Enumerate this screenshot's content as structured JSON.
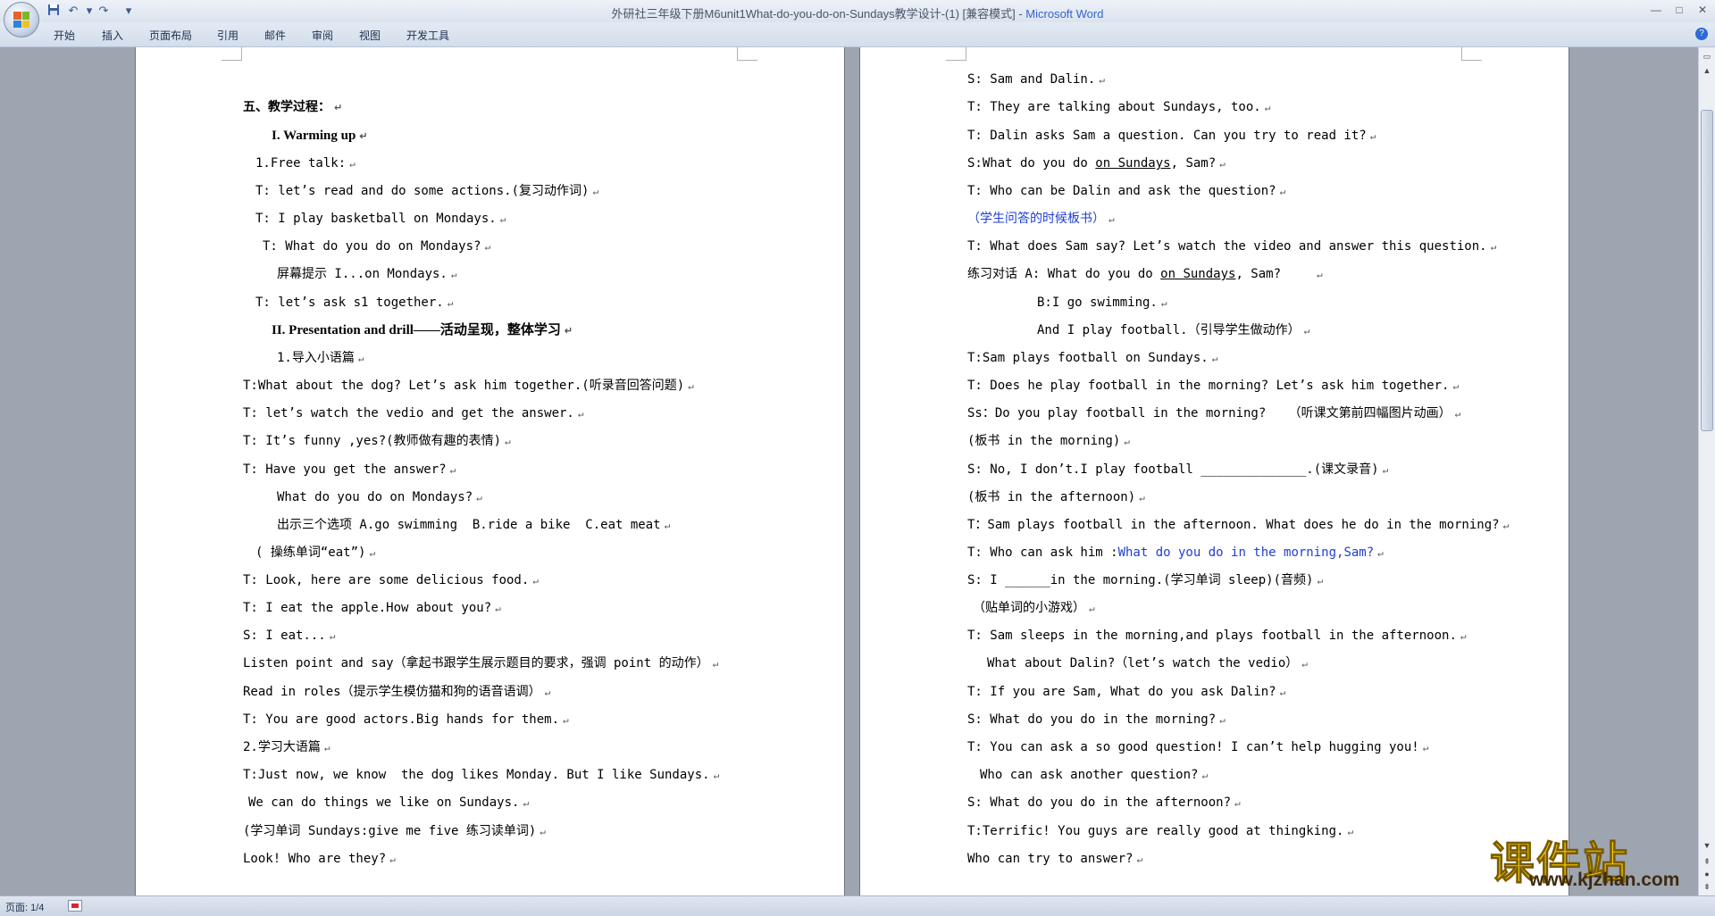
{
  "window": {
    "title": "外研社三年级下册M6unit1What-do-you-do-on-Sundays教学设计-(1) [兼容模式] - ",
    "app_name": "Microsoft Word"
  },
  "qat": {
    "save_icon": "save-icon",
    "undo": "↶",
    "redo": "↷",
    "customize": "▾"
  },
  "window_controls": {
    "minimize": "—",
    "maximize": "□",
    "close": "✕"
  },
  "ribbon": {
    "tabs": [
      "开始",
      "插入",
      "页面布局",
      "引用",
      "邮件",
      "审阅",
      "视图",
      "开发工具"
    ],
    "help": "?"
  },
  "page_left": {
    "lines": [
      {
        "text": "五、教学过程：",
        "style": "heading"
      },
      {
        "text": "I. Warming up",
        "style": "bold"
      },
      {
        "text": "1.Free talk:"
      },
      {
        "text": "T: let’s read and do some actions.(复习动作词)"
      },
      {
        "text": "T: I play basketball on Mondays."
      },
      {
        "text": "T: What do you do on Mondays?"
      },
      {
        "text": "屏幕提示 I...on Mondays."
      },
      {
        "text": "T: let’s ask s1 together."
      },
      {
        "text": "II. Presentation and drill——活动呈现，整体学习",
        "style": "bold"
      },
      {
        "text": "1.导入小语篇"
      },
      {
        "text": "T:What about the dog? Let’s ask him together.(听录音回答问题)"
      },
      {
        "text": "T: let’s watch the vedio and get the answer."
      },
      {
        "text": "T: It’s funny ,yes?(教师做有趣的表情)"
      },
      {
        "text": "T: Have you get the answer?"
      },
      {
        "text": "What do you do on Mondays?"
      },
      {
        "text": "出示三个选项 A.go swimming  B.ride a bike  C.eat meat"
      },
      {
        "text": "( 操练单词“eat”)"
      },
      {
        "text": "T: Look, here are some delicious food."
      },
      {
        "text": "T: I eat the apple.How about you?"
      },
      {
        "text": "S: I eat..."
      },
      {
        "text": "Listen point and say（拿起书跟学生展示题目的要求，强调 point 的动作）"
      },
      {
        "text": "Read in roles（提示学生模仿猫和狗的语音语调）"
      },
      {
        "text": "T: You are good actors.Big hands for them."
      },
      {
        "text": "2.学习大语篇"
      },
      {
        "text": "T:Just now, we know  the dog likes Monday. But I like Sundays."
      },
      {
        "text": "We can do things we like on Sundays."
      },
      {
        "text": "(学习单词 Sundays:give me five 练习读单词)"
      },
      {
        "text": "Look! Who are they?"
      }
    ]
  },
  "page_right": {
    "lines": [
      {
        "text": "S: Sam and Dalin."
      },
      {
        "text": "T: They are talking about Sundays, too."
      },
      {
        "text": "T: Dalin asks Sam a question. Can you try to read it?"
      },
      {
        "pre": "S:What do you do ",
        "under": "on Sundays",
        "post": ", Sam?"
      },
      {
        "text": "T: Who can be Dalin and ask the question?"
      },
      {
        "text": "（学生问答的时候板书）",
        "style": "blue"
      },
      {
        "text": "T: What does Sam say? Let’s watch the video and answer this question."
      },
      {
        "pre": "练习对话 A: What do you do ",
        "under": "on Sundays",
        "post": ", Sam?"
      },
      {
        "text": "B:I go swimming."
      },
      {
        "text": "And I play football.（引导学生做动作）"
      },
      {
        "text": "T:Sam plays football on Sundays."
      },
      {
        "text": "T: Does he play football in the morning? Let’s ask him together."
      },
      {
        "text": "Ss：Do you play football in the morning?   （听课文第前四幅图片动画）"
      },
      {
        "text": "(板书 in the morning)"
      },
      {
        "text": "S: No, I don’t.I play football ______________.(课文录音)"
      },
      {
        "text": "(板书 in the afternoon)"
      },
      {
        "text": "T：Sam plays football in the afternoon. What does he do in the morning?"
      },
      {
        "pre": "T: Who can ask him :",
        "blue": "What do you do in the morning,Sam?",
        "post": ""
      },
      {
        "text": "S: I ______in the morning.(学习单词 sleep)(音频)"
      },
      {
        "text": "（贴单词的小游戏）"
      },
      {
        "text": "T: Sam sleeps in the morning,and plays football in the afternoon."
      },
      {
        "text": "What about Dalin?（let’s watch the vedio）"
      },
      {
        "text": "T: If you are Sam, What do you ask Dalin?"
      },
      {
        "text": "S: What do you do in the morning?"
      },
      {
        "text": "T: You can ask a so good question! I can’t help hugging you!"
      },
      {
        "text": "Who can ask another question?"
      },
      {
        "text": "S: What do you do in the afternoon?"
      },
      {
        "text": "T:Terrific! You guys are really good at thingking."
      },
      {
        "text": "Who can try to answer?"
      }
    ]
  },
  "status": {
    "page": "页面: 1/4"
  },
  "watermark": {
    "logo_text": "课件站",
    "url": "www.kjzhan.com"
  },
  "colors": {
    "link_blue": "#1f3fd1",
    "watermark_yellow": "#f5cc00"
  }
}
